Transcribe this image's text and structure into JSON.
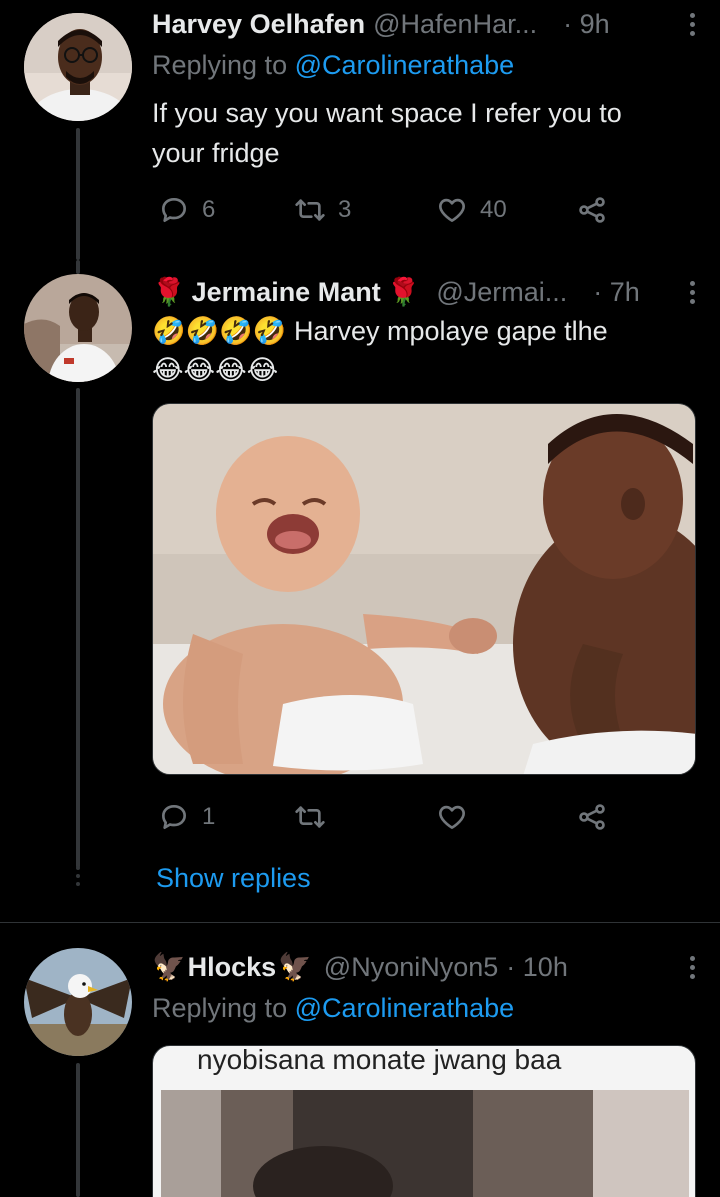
{
  "tweets": [
    {
      "name": "Harvey Oelhafen",
      "handle": "@HafenHar...",
      "time": "· 9h",
      "replying_prefix": "Replying to ",
      "replying_to": "@Carolinerathabe",
      "text": "If you say you want space I refer you to your fridge",
      "replies": "6",
      "retweets": "3",
      "likes": "40"
    },
    {
      "name_prefix_emoji": "🌹",
      "name": "Jermaine Mant",
      "name_suffix_emoji": "🌹",
      "handle": "@Jermai...",
      "time": "· 7h",
      "text_emojis_start": "🤣🤣🤣🤣",
      "text": " Harvey mpolaye gape tlhe",
      "text_emojis_end": "😂😂😂😂",
      "replies": "1",
      "retweets": "",
      "likes": "",
      "show_replies": "Show replies"
    },
    {
      "name_prefix_emoji": "🦅",
      "name": "Hlocks",
      "name_suffix_emoji": "🦅",
      "handle": "@NyoniNyon5",
      "time": "· 10h",
      "replying_prefix": "Replying to ",
      "replying_to": "@Carolinerathabe",
      "media_caption": "nyobisana monate jwang baa"
    }
  ],
  "colors": {
    "background": "#000000",
    "text": "#e7e9ea",
    "muted": "#71767b",
    "accent": "#1d9bf0",
    "divider": "#2f3336"
  },
  "icons": [
    "reply-icon",
    "retweet-icon",
    "like-icon",
    "share-icon",
    "more-icon"
  ]
}
